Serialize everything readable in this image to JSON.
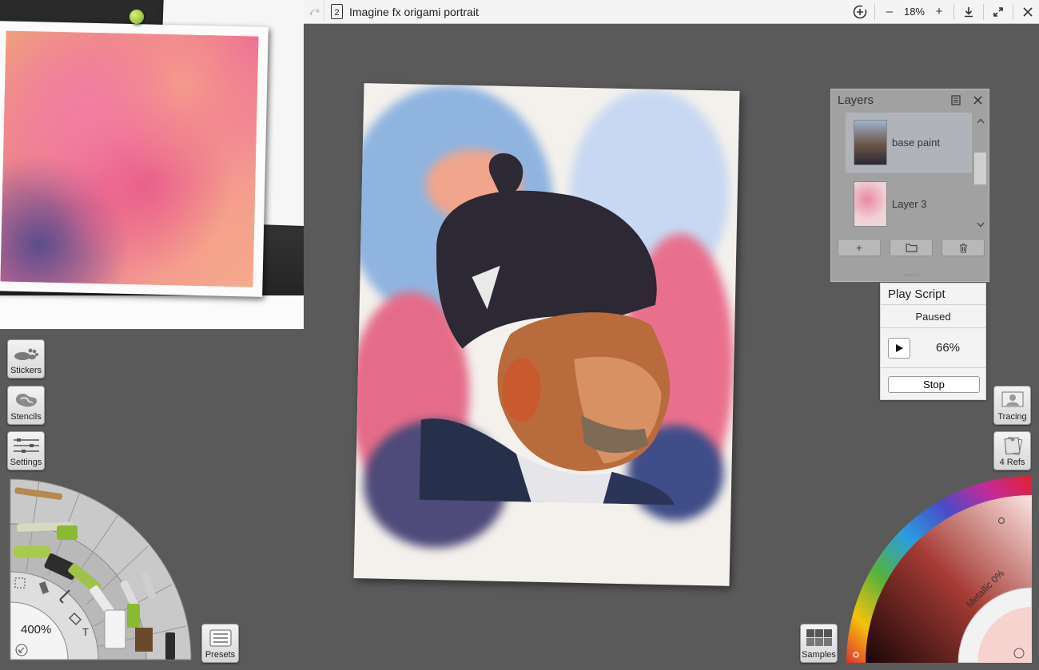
{
  "topbar": {
    "doc_number": "2",
    "doc_title": "Imagine fx origami portrait",
    "zoom_minus": "–",
    "zoom_value": "18%",
    "zoom_plus": "+",
    "icons": [
      "redo-icon",
      "document-icon",
      "timelapse-add-icon",
      "download-icon",
      "expand-icon",
      "close-icon"
    ]
  },
  "layers": {
    "title": "Layers",
    "items": [
      {
        "name": "base paint"
      },
      {
        "name": "Layer 3"
      }
    ],
    "add_label": "+",
    "icons": [
      "layers-menu-icon",
      "close-icon",
      "scroll-up-icon",
      "scroll-down-icon",
      "folder-icon",
      "trash-icon"
    ]
  },
  "playscript": {
    "title": "Play Script",
    "status": "Paused",
    "progress": "66%",
    "stop_label": "Stop"
  },
  "left_tools": [
    {
      "label": "Stickers",
      "icon": "stickers-icon"
    },
    {
      "label": "Stencils",
      "icon": "stencils-icon"
    },
    {
      "label": "Settings",
      "icon": "settings-icon"
    }
  ],
  "right_tools": [
    {
      "label": "Tracing",
      "icon": "tracing-icon"
    },
    {
      "label": "4 Refs",
      "icon": "references-icon"
    }
  ],
  "tool_wheel": {
    "zoom": "400%",
    "text_tool_glyph": "T"
  },
  "presets_label": "Presets",
  "samples_label": "Samples",
  "color_wheel": {
    "metallic_label": "Metallic 0%"
  },
  "colors": {
    "background": "#5a5a5a",
    "topbar": "#f4f4f4",
    "panel": "#f3f3f3",
    "accent_green": "#8ab934"
  }
}
